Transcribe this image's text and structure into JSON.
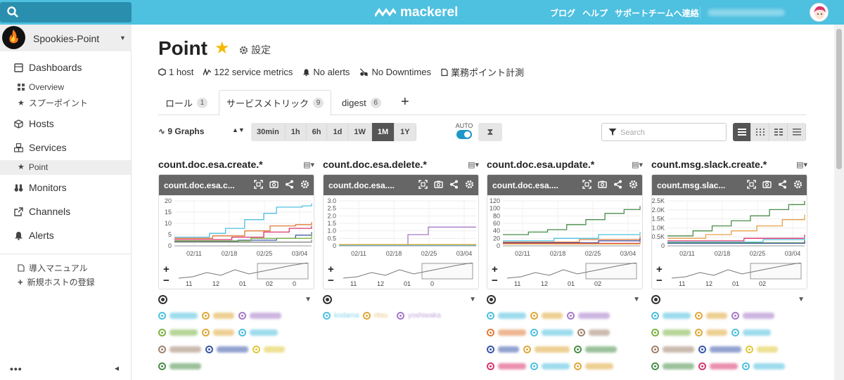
{
  "topbar": {
    "brand": "mackerel",
    "links": [
      "ブログ",
      "ヘルプ",
      "サポートチームへ連絡"
    ],
    "search_icon": "search-icon",
    "avatar_icon": "user-avatar"
  },
  "sidebar": {
    "org_name": "Spookies-Point",
    "org_logo_text": "Spookies",
    "nav": {
      "dashboards": "Dashboards",
      "dashboard_items": [
        "Overview",
        "スプーポイント"
      ],
      "hosts": "Hosts",
      "services": "Services",
      "service_items": [
        "Point"
      ],
      "monitors": "Monitors",
      "channels": "Channels",
      "alerts": "Alerts"
    },
    "links": [
      "導入マニュアル",
      "新規ホストの登録"
    ],
    "more": "•••",
    "collapse": "◂"
  },
  "page": {
    "title": "Point",
    "star": "★",
    "settings": "設定",
    "meta": {
      "hosts": "1 host",
      "service_metrics": "122 service metrics",
      "alerts": "No alerts",
      "downtimes": "No Downtimes",
      "memo": "業務ポイント計測"
    }
  },
  "tabs": [
    {
      "label": "ロール",
      "count": "1"
    },
    {
      "label": "サービスメトリック",
      "count": "9"
    },
    {
      "label": "digest",
      "count": "6"
    }
  ],
  "tab_add": "+",
  "toolbar": {
    "graphs": "9 Graphs",
    "ranges": [
      "30min",
      "1h",
      "6h",
      "1d",
      "1W",
      "1M",
      "1Y"
    ],
    "active_range": "1M",
    "auto_label": "AUTO",
    "auto_on": true,
    "filter_placeholder": "Search",
    "layouts": [
      "list-1-col-icon",
      "grid-4-col-icon",
      "grid-3-col-icon",
      "list-icon"
    ]
  },
  "graphs": [
    {
      "title": "count.doc.esa.create.*",
      "short": "count.doc.esa.c...",
      "y_ticks": [
        "20",
        "15",
        "10",
        "5",
        "0"
      ],
      "x_ticks": [
        "02/11",
        "02/18",
        "02/25",
        "03/04"
      ],
      "nav_ticks": [
        "11",
        "12",
        "01",
        "02",
        "0"
      ]
    },
    {
      "title": "count.doc.esa.delete.*",
      "short": "count.doc.esa....",
      "y_ticks": [
        "3.0",
        "2.5",
        "2.0",
        "1.5",
        "1.0",
        "0.5",
        "0"
      ],
      "x_ticks": [
        "02/11",
        "02/18",
        "02/25",
        "03/04"
      ],
      "nav_ticks": [
        "11",
        "12",
        "01",
        "0"
      ],
      "legend": [
        "kodama",
        "ritsu",
        "yoshiwaka"
      ]
    },
    {
      "title": "count.doc.esa.update.*",
      "short": "count.doc.esa....",
      "y_ticks": [
        "120",
        "100",
        "80",
        "60",
        "40",
        "20",
        "0"
      ],
      "x_ticks": [
        "02/11",
        "02/18",
        "02/25",
        "03/04"
      ],
      "nav_ticks": [
        "11",
        "12",
        "01",
        "02"
      ]
    },
    {
      "title": "count.msg.slack.create.*",
      "short": "count.msg.slac...",
      "y_ticks": [
        "2.5K",
        "2.0K",
        "1.5K",
        "1.0K",
        "0.5K",
        "0"
      ],
      "x_ticks": [
        "02/11",
        "02/18",
        "02/25",
        "03/04"
      ],
      "nav_ticks": [
        "11",
        "12",
        "01",
        "02"
      ]
    }
  ],
  "colors": {
    "topbar": "#4ec0e0",
    "accent": "#1f96c8",
    "star": "#f5b800",
    "panel_head": "#666666"
  }
}
